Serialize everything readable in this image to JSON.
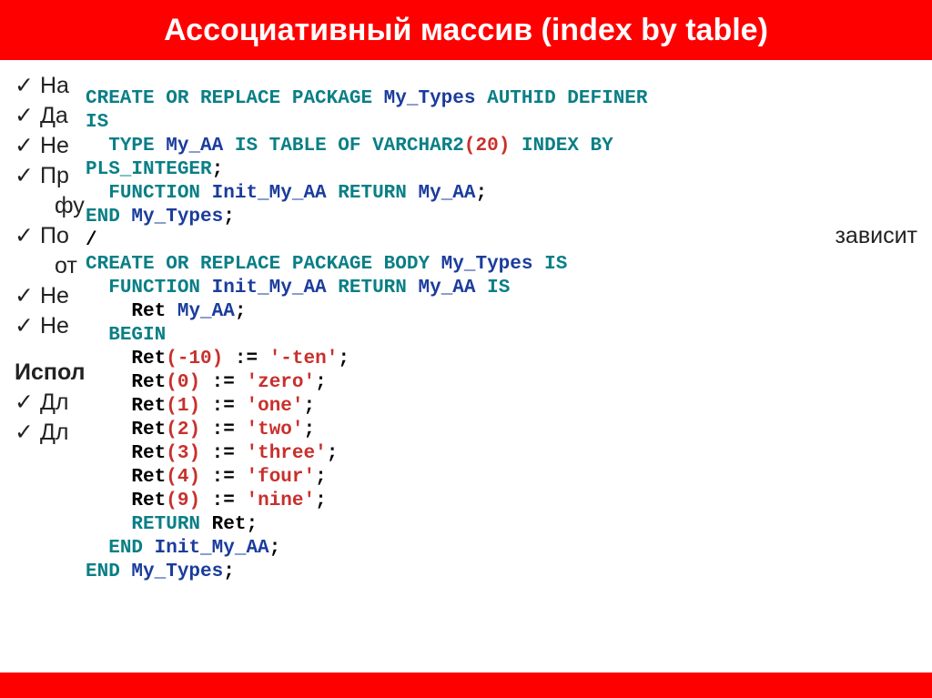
{
  "title": "Ассоциативный массив (index by table)",
  "bg": {
    "r1": "На",
    "r2": "Да",
    "r3": "Не",
    "r4": "Пр",
    "r4b": "фу",
    "r5": "По",
    "r5_tail": "  зависит",
    "r5b": "от",
    "r6": "Не",
    "r7": "Не",
    "section": "Испол",
    "r8": "Дл",
    "r9": "Дл",
    "tick": "✓"
  },
  "code": {
    "l1_a": "CREATE OR REPLACE PACKAGE ",
    "l1_b": "My_Types",
    "l1_c": " AUTHID DEFINER IS",
    "l2_a": "  TYPE ",
    "l2_b": "My_AA",
    "l2_c": " IS TABLE OF VARCHAR2",
    "l2_d": "(",
    "l2_e": "20",
    "l2_f": ")",
    "l2_g": " INDEX BY PLS_INTEGER",
    "l2_h": ";",
    "l3_a": "  FUNCTION ",
    "l3_b": "Init_My_AA",
    "l3_c": " RETURN ",
    "l3_d": "My_AA",
    "l3_e": ";",
    "l4_a": "END ",
    "l4_b": "My_Types",
    "l4_c": ";",
    "l5": "/",
    "l6_a": "CREATE OR REPLACE PACKAGE BODY ",
    "l6_b": "My_Types",
    "l6_c": " IS",
    "l7_a": "  FUNCTION ",
    "l7_b": "Init_My_AA",
    "l7_c": " RETURN ",
    "l7_d": "My_AA",
    "l7_e": " IS",
    "l8_a": "    Ret ",
    "l8_b": "My_AA",
    "l8_c": ";",
    "l9": "  BEGIN",
    "l10_a": "    Ret",
    "l10_b": "(",
    "l10_c": "-10",
    "l10_d": ")",
    "l10_e": " := ",
    "l10_f": "'-ten'",
    "l10_g": ";",
    "l11_a": "    Ret",
    "l11_b": "(",
    "l11_c": "0",
    "l11_d": ")",
    "l11_e": " := ",
    "l11_f": "'zero'",
    "l11_g": ";",
    "l12_a": "    Ret",
    "l12_b": "(",
    "l12_c": "1",
    "l12_d": ")",
    "l12_e": " := ",
    "l12_f": "'one'",
    "l12_g": ";",
    "l13_a": "    Ret",
    "l13_b": "(",
    "l13_c": "2",
    "l13_d": ")",
    "l13_e": " := ",
    "l13_f": "'two'",
    "l13_g": ";",
    "l14_a": "    Ret",
    "l14_b": "(",
    "l14_c": "3",
    "l14_d": ")",
    "l14_e": " := ",
    "l14_f": "'three'",
    "l14_g": ";",
    "l15_a": "    Ret",
    "l15_b": "(",
    "l15_c": "4",
    "l15_d": ")",
    "l15_e": " := ",
    "l15_f": "'four'",
    "l15_g": ";",
    "l16_a": "    Ret",
    "l16_b": "(",
    "l16_c": "9",
    "l16_d": ")",
    "l16_e": " := ",
    "l16_f": "'nine'",
    "l16_g": ";",
    "l17_a": "    RETURN ",
    "l17_b": "Ret",
    "l17_c": ";",
    "l18_a": "  END ",
    "l18_b": "Init_My_AA",
    "l18_c": ";",
    "l19_a": "END ",
    "l19_b": "My_Types",
    "l19_c": ";"
  }
}
